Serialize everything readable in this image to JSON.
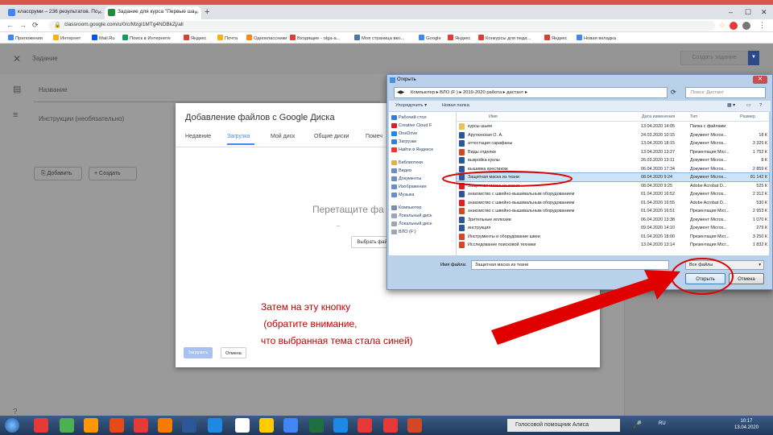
{
  "browser": {
    "tabs": [
      {
        "label": "классруми – 236 результатов. По...",
        "fav_color": "#4285f4"
      },
      {
        "label": "Задание для курса \"Первые ша...",
        "fav_color": "#1e8e3e"
      }
    ],
    "new_tab": "+",
    "window_controls": [
      "–",
      "☐",
      "✕"
    ],
    "url": "classroom.google.com/u/0/c/MzgI1MTg4NDBkZj/all",
    "bookmarks": [
      {
        "label": "Приложения",
        "color": "#4285f4"
      },
      {
        "label": "Интернет",
        "color": "#f4b400"
      },
      {
        "label": "Mail.Ru",
        "color": "#0055ff"
      },
      {
        "label": "Поиск в Интернете",
        "color": "#0f9d58"
      },
      {
        "label": "Яндекс",
        "color": "#e53935"
      },
      {
        "label": "Почта",
        "color": "#f4b400"
      },
      {
        "label": "Одноклассники",
        "color": "#ff8800"
      },
      {
        "label": "Входящие - olga-a...",
        "color": "#e53935"
      },
      {
        "label": "Моя страница вко...",
        "color": "#4a76a8"
      },
      {
        "label": "Google",
        "color": "#4285f4"
      },
      {
        "label": "Яндекс",
        "color": "#e53935"
      },
      {
        "label": "Конкурсы для педа...",
        "color": "#e53935"
      },
      {
        "label": "Яндекс",
        "color": "#e53935"
      },
      {
        "label": "Новая вкладка",
        "color": "#4285f4"
      }
    ]
  },
  "classroom": {
    "header_title": "Задание",
    "create_button": "Создать задание",
    "title_field": "Название",
    "instructions_field": "Инструкции (необязательно)",
    "add_button": "Добавить",
    "create_button_small": "Создать"
  },
  "gdrive": {
    "title": "Добавление файлов с Google Диска",
    "tabs": [
      "Недавние",
      "Загрузка",
      "Мой диск",
      "Общие диски",
      "Помеч"
    ],
    "drop_text": "Перетащите фа",
    "or_text": "–",
    "select_button": "Выбрать файлы",
    "upload_button": "Загрузить",
    "cancel_button": "Отмена"
  },
  "open_dialog": {
    "title": "Открыть",
    "path": "Компьютер ▸ ВЛО (F:) ▸ 2019-2020 работа ▸ дистант ▸",
    "search_placeholder": "Поиск: Дистант",
    "toolbar": [
      "Упорядочить ▾",
      "Новая папка"
    ],
    "nav": [
      {
        "label": "Рабочий стол",
        "color": "#3a7bd5"
      },
      {
        "label": "Creative Cloud F",
        "color": "#da1f26"
      },
      {
        "label": "OneDrive",
        "color": "#1e88e5"
      },
      {
        "label": "Загрузки",
        "color": "#3a7bd5"
      },
      {
        "label": "Найти в Яндексе",
        "color": "#e53935"
      },
      {
        "label": "Библиотеки",
        "color": "#e0b050"
      },
      {
        "label": "Видео",
        "color": "#6a8cc7"
      },
      {
        "label": "Документы",
        "color": "#6a8cc7"
      },
      {
        "label": "Изображения",
        "color": "#6a8cc7"
      },
      {
        "label": "Музыка",
        "color": "#6a8cc7"
      },
      {
        "label": "Компьютер",
        "color": "#7a8ca8"
      },
      {
        "label": "Локальный диск",
        "color": "#9aa5b5"
      },
      {
        "label": "Локальный диск",
        "color": "#9aa5b5"
      },
      {
        "label": "ВЛО (F:)",
        "color": "#9aa5b5"
      }
    ],
    "columns": [
      "Имя",
      "Дата изменения",
      "Тип",
      "Размер"
    ],
    "files": [
      {
        "name": "курсы шьем",
        "date": "13.04.2020 14:05",
        "type": "Папка с файлами",
        "size": "",
        "color": "#e8c15a"
      },
      {
        "name": "Арутюнская О. А.",
        "date": "24.03.2020 10:15",
        "type": "Документ Micros...",
        "size": "18 К",
        "color": "#2b5797"
      },
      {
        "name": "аттестация сарафаны",
        "date": "13.04.2020 18:15",
        "type": "Документ Micros...",
        "size": "3 325 К",
        "color": "#2b5797"
      },
      {
        "name": "Виды отделки",
        "date": "13.04.2020 13:27",
        "type": "Презентация Micr...",
        "size": "1 752 К",
        "color": "#d24726"
      },
      {
        "name": "выкройка куклы",
        "date": "26.03.2020 13:11",
        "type": "Документ Micros...",
        "size": "8 К",
        "color": "#2b5797"
      },
      {
        "name": "вышивка крестиком",
        "date": "06.04.2020 17:34",
        "type": "Документ Micros...",
        "size": "2 859 К",
        "color": "#2b5797"
      },
      {
        "name": "Защитная маска из ткани",
        "date": "08.04.2020 9:24",
        "type": "Документ Micros...",
        "size": "81 142 К",
        "color": "#2b5797",
        "selected": true
      },
      {
        "name": "Защитная маска из ткани",
        "date": "08.04.2020 9:25",
        "type": "Adobe Acrobat D...",
        "size": "525 К",
        "color": "#da1f26"
      },
      {
        "name": "знакомство с швейно-вышивальным оборудованием",
        "date": "01.04.2020 16:52",
        "type": "Документ Micros...",
        "size": "2 312 К",
        "color": "#2b5797"
      },
      {
        "name": "знакомство с швейно-вышивальным оборудованием",
        "date": "01.04.2020 16:55",
        "type": "Adobe Acrobat D...",
        "size": "530 К",
        "color": "#da1f26"
      },
      {
        "name": "знакомство с швейно-вышивальным оборудованием",
        "date": "01.04.2020 16:51",
        "type": "Презентация Micr...",
        "size": "2 953 К",
        "color": "#d24726"
      },
      {
        "name": "Зрительные иллюзии",
        "date": "06.04.2020 13:38",
        "type": "Документ Micros...",
        "size": "1 070 К",
        "color": "#2b5797"
      },
      {
        "name": "инструкция",
        "date": "09.04.2020 14:10",
        "type": "Документ Micros...",
        "size": "279 К",
        "color": "#2b5797"
      },
      {
        "name": "Инструменты и оборудование швеи",
        "date": "01.04.2020 18:00",
        "type": "Презентация Micr...",
        "size": "3 250 К",
        "color": "#d24726"
      },
      {
        "name": "Исследование поисковой техники",
        "date": "13.04.2020 13:14",
        "type": "Презентация Micr...",
        "size": "1 832 К",
        "color": "#d24726"
      }
    ],
    "filename_label": "Имя файла:",
    "filename_value": "Защитная маска из ткани",
    "filter": "Все файлы",
    "open_button": "Открыть",
    "cancel_button": "Отмена"
  },
  "annotation": {
    "text": "Затем на эту кнопку\n (обратите внимание,\nчто выбранная тема стала синей)",
    "color": "#c00000"
  },
  "taskbar": {
    "search_text": "Голосовой помощник Алиса",
    "lang": "RU",
    "time": "10:17",
    "date": "13.04.2020",
    "apps": [
      "#e53935",
      "#4caf50",
      "#ff9800",
      "#e64a19",
      "#e53935",
      "#f57c00",
      "#2b5797",
      "#1e88e5",
      "#fff",
      "#ffcc00",
      "#4285f4",
      "#1d6f42",
      "#1e88e5",
      "#e53935",
      "#e53935",
      "#d24726"
    ]
  }
}
